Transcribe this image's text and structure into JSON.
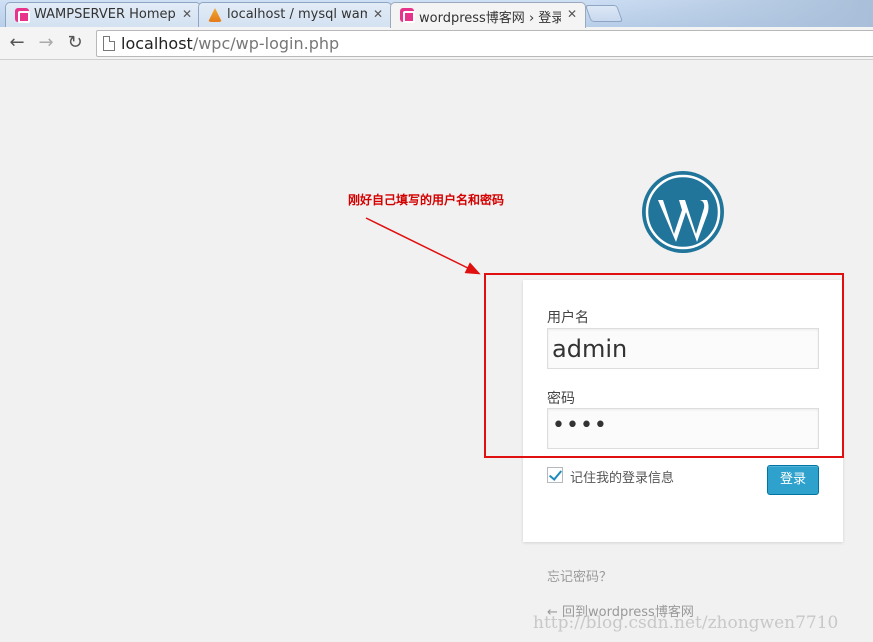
{
  "browser": {
    "tabs": [
      {
        "title": "WAMPSERVER Homepa",
        "favicon": "wampserver-icon",
        "active": false
      },
      {
        "title": "localhost / mysql wamp",
        "favicon": "phpmyadmin-icon",
        "active": false
      },
      {
        "title": "wordpress博客网 › 登录",
        "favicon": "wampserver-icon",
        "active": true
      }
    ],
    "close_glyph": "✕",
    "url_host": "localhost",
    "url_path": "/wpc/wp-login.php"
  },
  "annotation": {
    "text": "刚好自己填写的用户名和密码",
    "color": "#d40000"
  },
  "login": {
    "username_label": "用户名",
    "username_value": "admin",
    "password_label": "密码",
    "password_value": "••••",
    "remember_label": "记住我的登录信息",
    "remember_checked": true,
    "submit_label": "登录"
  },
  "links": {
    "lost_password": "忘记密码？",
    "back_to_blog": "← 回到wordpress博客网"
  },
  "watermark": "http://blog.csdn.net/zhongwen7710",
  "colors": {
    "wp_blue": "#21759b",
    "button_blue": "#2ea2cc",
    "highlight_red": "#e01010",
    "page_bg": "#f1f1f1"
  }
}
